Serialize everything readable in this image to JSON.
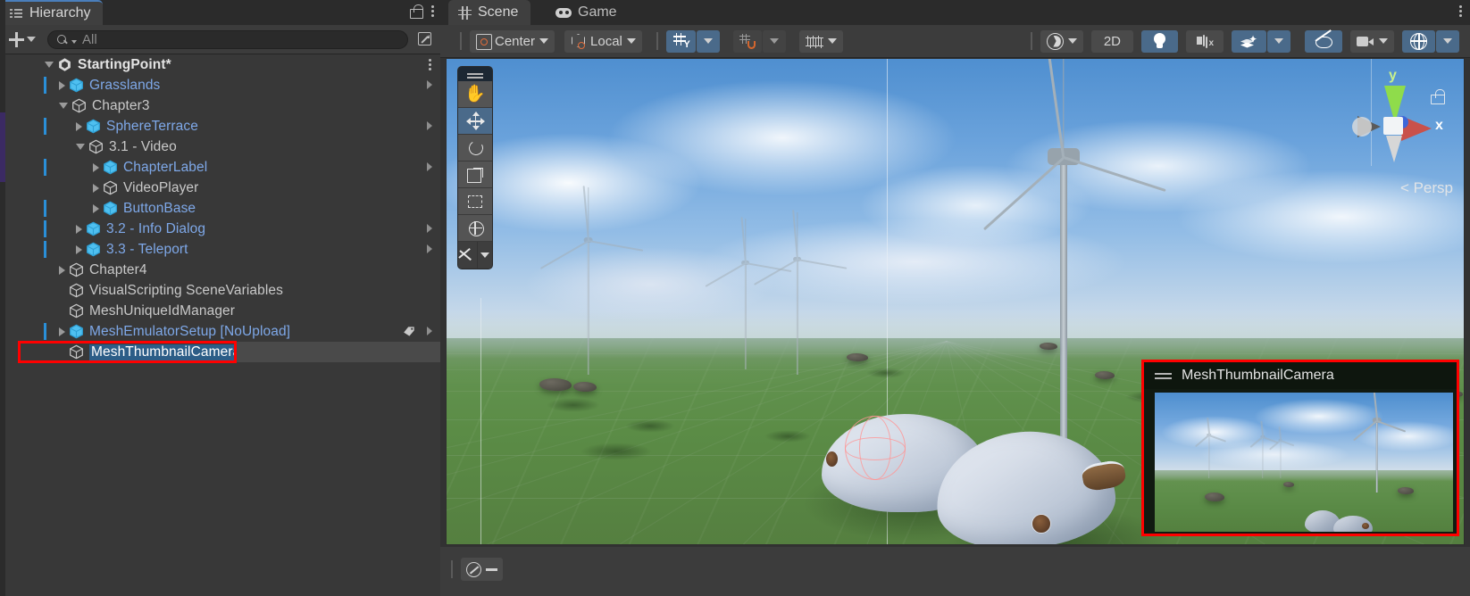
{
  "hierarchy": {
    "tab_label": "Hierarchy",
    "tab_icon": "hierarchy-icon",
    "lock_icon": "lock-icon",
    "menu_icon": "kebab-menu-icon",
    "add_label": "+",
    "search": {
      "placeholder": "All",
      "value": "",
      "icon": "search-icon"
    },
    "sort_icon": "sort-icon",
    "scene_root": {
      "label": "StartingPoint*",
      "icon": "unity-scene-icon",
      "expanded": true
    },
    "items": [
      {
        "label": "Grasslands",
        "depth": 1,
        "icon": "prefab-cube-icon",
        "twisty": "closed",
        "color": "blue",
        "prefab_bar": true,
        "chevron": true,
        "tag": false
      },
      {
        "label": "Chapter3",
        "depth": 1,
        "icon": "gameobject-icon",
        "twisty": "open",
        "color": "grey",
        "prefab_bar": false,
        "chevron": false,
        "tag": false
      },
      {
        "label": "SphereTerrace",
        "depth": 2,
        "icon": "prefab-variant-icon",
        "twisty": "closed",
        "color": "blue",
        "prefab_bar": true,
        "chevron": true,
        "tag": false
      },
      {
        "label": "3.1 - Video",
        "depth": 2,
        "icon": "gameobject-icon",
        "twisty": "open",
        "color": "grey",
        "prefab_bar": false,
        "chevron": false,
        "tag": false
      },
      {
        "label": "ChapterLabel",
        "depth": 3,
        "icon": "prefab-cube-icon",
        "twisty": "closed",
        "color": "blue",
        "prefab_bar": true,
        "chevron": true,
        "tag": false
      },
      {
        "label": "VideoPlayer",
        "depth": 3,
        "icon": "gameobject-icon",
        "twisty": "closed",
        "color": "grey",
        "prefab_bar": false,
        "chevron": false,
        "tag": false
      },
      {
        "label": "ButtonBase",
        "depth": 3,
        "icon": "prefab-cube-icon",
        "twisty": "closed",
        "color": "blue",
        "prefab_bar": true,
        "chevron": false,
        "tag": false
      },
      {
        "label": "3.2 - Info Dialog",
        "depth": 2,
        "icon": "prefab-cube-icon",
        "twisty": "closed",
        "color": "blue",
        "prefab_bar": true,
        "chevron": true,
        "tag": false
      },
      {
        "label": "3.3 - Teleport",
        "depth": 2,
        "icon": "prefab-cube-icon",
        "twisty": "closed",
        "color": "blue",
        "prefab_bar": true,
        "chevron": true,
        "tag": false
      },
      {
        "label": "Chapter4",
        "depth": 1,
        "icon": "gameobject-icon",
        "twisty": "closed",
        "color": "grey",
        "prefab_bar": false,
        "chevron": false,
        "tag": false
      },
      {
        "label": "VisualScripting SceneVariables",
        "depth": 1,
        "icon": "gameobject-icon",
        "twisty": "none",
        "color": "grey",
        "prefab_bar": false,
        "chevron": false,
        "tag": false
      },
      {
        "label": "MeshUniqueIdManager",
        "depth": 1,
        "icon": "gameobject-icon",
        "twisty": "none",
        "color": "grey",
        "prefab_bar": false,
        "chevron": false,
        "tag": false
      },
      {
        "label": "MeshEmulatorSetup [NoUpload]",
        "depth": 1,
        "icon": "prefab-cube-icon",
        "twisty": "closed",
        "color": "blue",
        "prefab_bar": true,
        "chevron": true,
        "tag": true
      },
      {
        "label": "MeshThumbnailCamera",
        "depth": 1,
        "icon": "gameobject-icon",
        "twisty": "none",
        "color": "white",
        "prefab_bar": false,
        "chevron": false,
        "tag": false,
        "selected": true,
        "highlight": true
      }
    ]
  },
  "scene": {
    "tabs": [
      {
        "label": "Scene",
        "icon": "grid-icon",
        "active": true
      },
      {
        "label": "Game",
        "icon": "gamepad-icon",
        "active": false
      }
    ],
    "menu_icon": "kebab-menu-icon",
    "toolbar": {
      "pivot_mode": "Center",
      "pivot_icon": "pivot-center-icon",
      "handle_space": "Local",
      "handle_icon": "handle-local-icon",
      "grid_axis_label": "Y",
      "grid_icon": "grid-axis-y-icon",
      "snap_icon": "snap-magnet-icon",
      "snap_increment_icon": "snap-ruler-icon",
      "shading_icon": "shading-mode-icon",
      "view_2d_label": "2D",
      "lighting_icon": "scene-lighting-icon",
      "audio_icon": "scene-audio-mute-icon",
      "fx_icon": "scene-effects-icon",
      "hidden_objects_icon": "hidden-objects-eye-icon",
      "camera_icon": "scene-camera-icon",
      "gizmos_icon": "gizmos-globe-icon"
    },
    "tools": [
      {
        "name": "hand-tool",
        "icon": "hand-icon",
        "active": false
      },
      {
        "name": "move-tool",
        "icon": "move-icon",
        "active": true
      },
      {
        "name": "rotate-tool",
        "icon": "rotate-icon",
        "active": false
      },
      {
        "name": "scale-tool",
        "icon": "scale-icon",
        "active": false
      },
      {
        "name": "rect-tool",
        "icon": "rect-transform-icon",
        "active": false
      },
      {
        "name": "transform-tool",
        "icon": "transform-icon",
        "active": false
      },
      {
        "name": "custom-tools",
        "icon": "custom-tools-icon",
        "active": false
      }
    ],
    "gizmo": {
      "axis_y_label": "y",
      "axis_x_label": "x",
      "projection_label": "< Persp",
      "lock_icon": "gizmo-lock-icon"
    },
    "camera_preview": {
      "title": "MeshThumbnailCamera",
      "handle_icon": "drag-handle-icon"
    },
    "bottom_bar": {
      "orientation_icon": "compass-icon"
    }
  },
  "colors": {
    "selection_highlight": "#ff0000",
    "selected_row": "#2c5d87",
    "prefab_blue": "#7ea8e8",
    "accent_blue": "#4a6a8a",
    "panel_bg": "#383838",
    "toolbar_bg": "#3c3c3c",
    "tabbar_bg": "#2b2b2b"
  }
}
